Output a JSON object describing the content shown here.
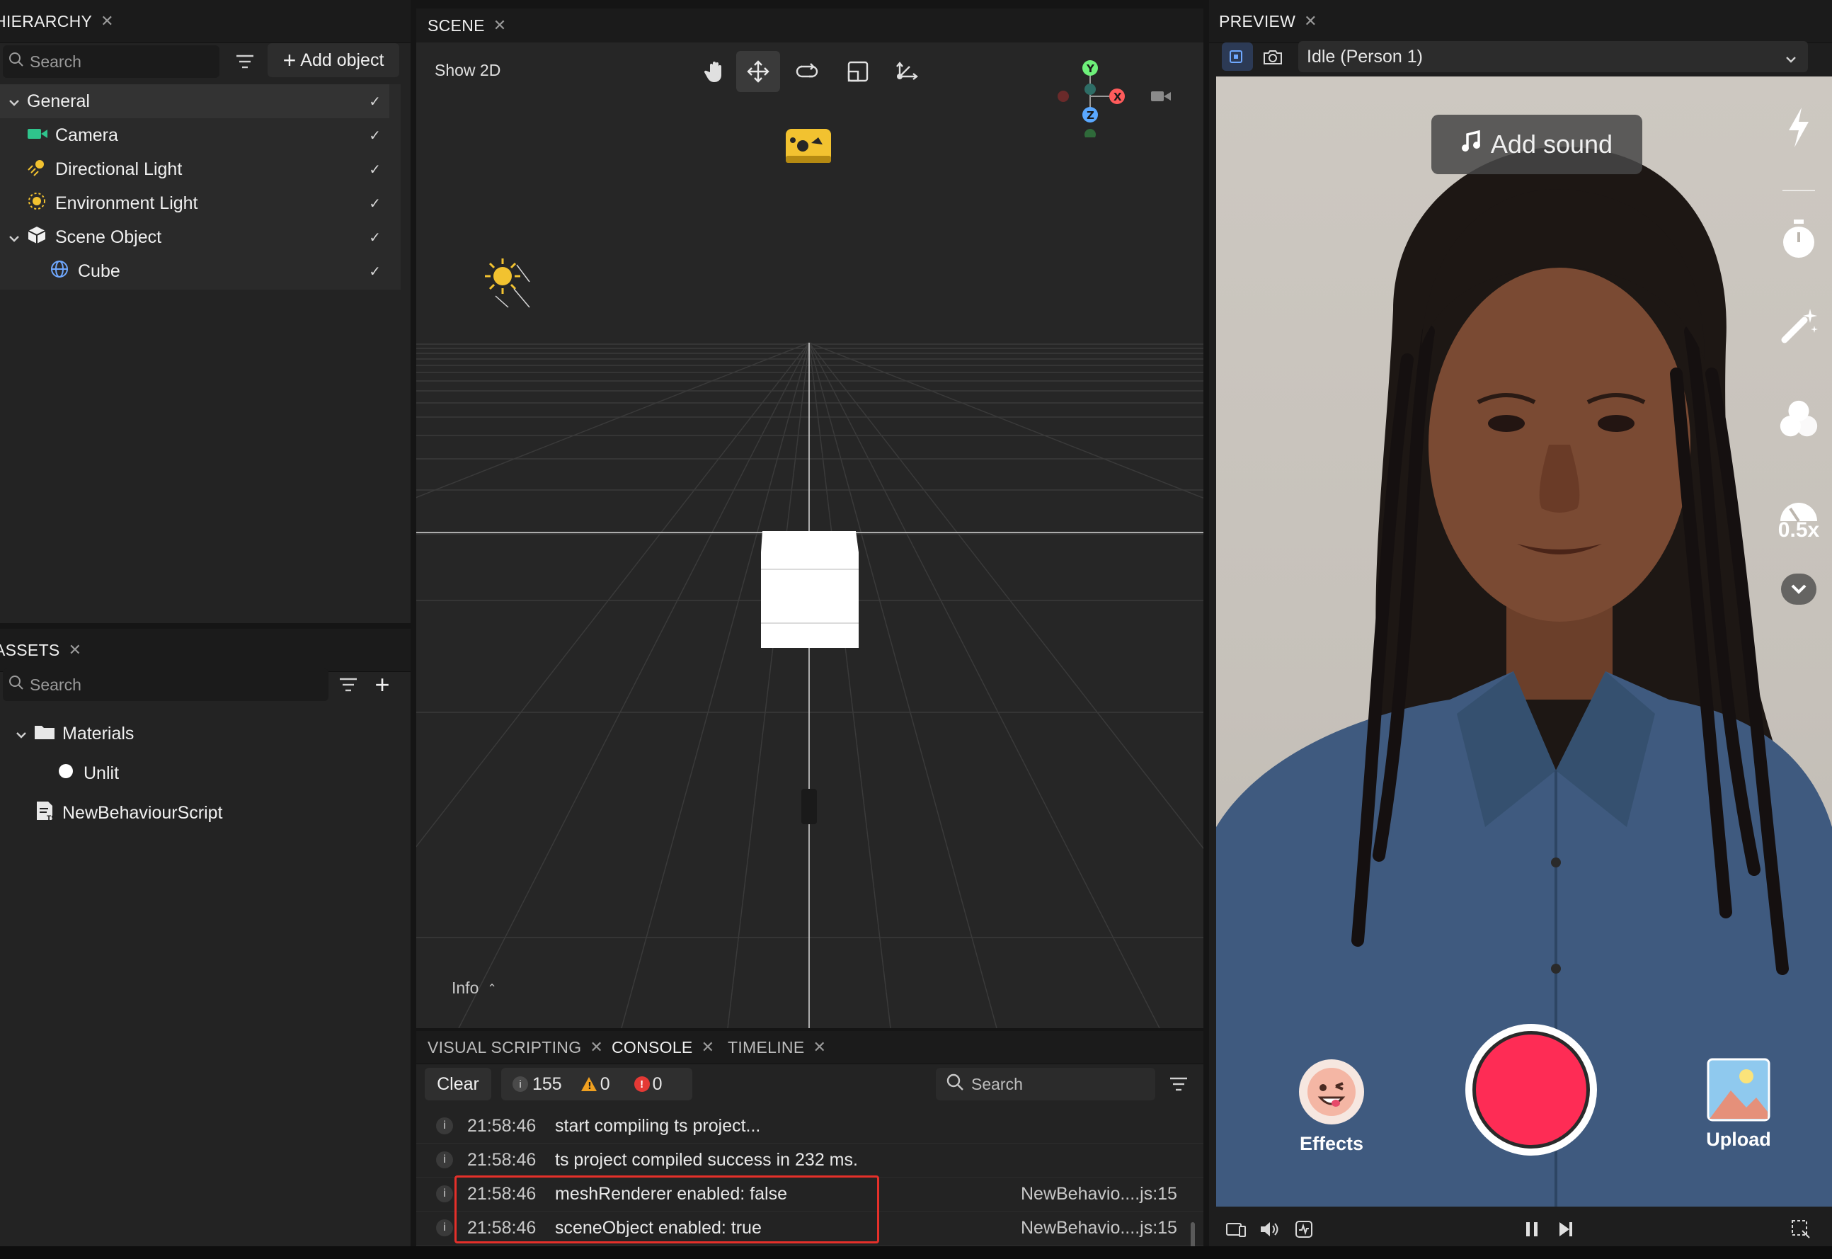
{
  "hierarchy": {
    "tab_label": "HIERARCHY",
    "search_placeholder": "Search",
    "add_object_label": "Add object",
    "items": [
      {
        "label": "General",
        "icon": "chevron-down-icon"
      },
      {
        "label": "Camera",
        "icon": "camera-icon"
      },
      {
        "label": "Directional Light",
        "icon": "directional-light-icon"
      },
      {
        "label": "Environment Light",
        "icon": "environment-light-icon"
      },
      {
        "label": "Scene Object",
        "icon": "scene-object-icon"
      },
      {
        "label": "Cube",
        "icon": "mesh-globe-icon"
      }
    ]
  },
  "assets": {
    "tab_label": "ASSETS",
    "search_placeholder": "Search",
    "items": [
      {
        "label": "Materials",
        "icon": "folder-icon"
      },
      {
        "label": "Unlit",
        "icon": "material-dot-icon"
      },
      {
        "label": "NewBehaviourScript",
        "icon": "script-file-icon"
      }
    ]
  },
  "scene": {
    "tab_label": "SCENE",
    "show2d_label": "Show 2D",
    "info_label": "Info",
    "gizmo": {
      "y": "Y",
      "x": "X",
      "z": "Z"
    },
    "tools": [
      "hand-icon",
      "move-icon",
      "rotate-icon",
      "scale-icon",
      "transform-icon"
    ]
  },
  "bottom_tabs": {
    "visual_scripting": "VISUAL SCRIPTING",
    "console": "CONSOLE",
    "timeline": "TIMELINE"
  },
  "console": {
    "clear_label": "Clear",
    "info_count": "155",
    "warn_count": "0",
    "error_count": "0",
    "search_placeholder": "Search",
    "rows": [
      {
        "time": "21:58:46",
        "message": "start compiling ts project...",
        "source": ""
      },
      {
        "time": "21:58:46",
        "message": "ts project compiled success in 232 ms.",
        "source": ""
      },
      {
        "time": "21:58:46",
        "message": "meshRenderer enabled: false",
        "source": "NewBehavio....js:15"
      },
      {
        "time": "21:58:46",
        "message": "sceneObject enabled: true",
        "source": "NewBehavio....js:15"
      }
    ],
    "highlight_color": "#e5302a"
  },
  "preview": {
    "tab_label": "PREVIEW",
    "person_select": "Idle (Person 1)",
    "add_sound_label": "Add sound",
    "speed_label": "0.5x",
    "effects_label": "Effects",
    "upload_label": "Upload",
    "record_color": "#fe2c55"
  }
}
